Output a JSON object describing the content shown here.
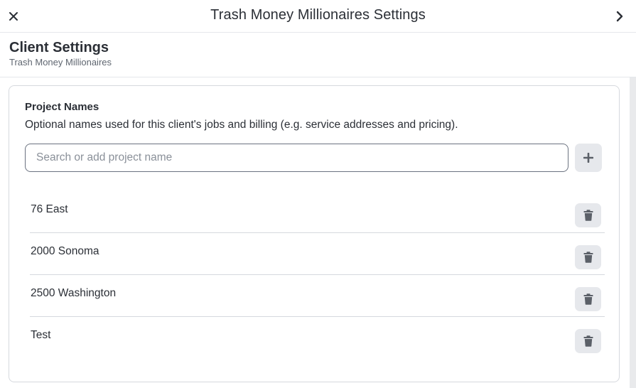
{
  "header": {
    "title": "Trash Money Millionaires Settings",
    "close_icon": "close-icon",
    "next_icon": "chevron-right-icon"
  },
  "section": {
    "title": "Client Settings",
    "subtitle": "Trash Money Millionaires"
  },
  "project_names": {
    "title": "Project Names",
    "description": "Optional names used for this client's jobs and billing (e.g. service addresses and pricing).",
    "search": {
      "placeholder": "Search or add project name",
      "value": ""
    },
    "add_icon": "plus-icon",
    "items": [
      {
        "name": "76 East"
      },
      {
        "name": "2000 Sonoma"
      },
      {
        "name": "2500 Washington"
      },
      {
        "name": "Test"
      }
    ],
    "delete_icon": "trash-icon"
  },
  "colors": {
    "text": "#2b2f36",
    "muted": "#5f6670",
    "border": "#d6d9de",
    "button_bg": "#e6e8ec",
    "icon": "#5b6068"
  }
}
